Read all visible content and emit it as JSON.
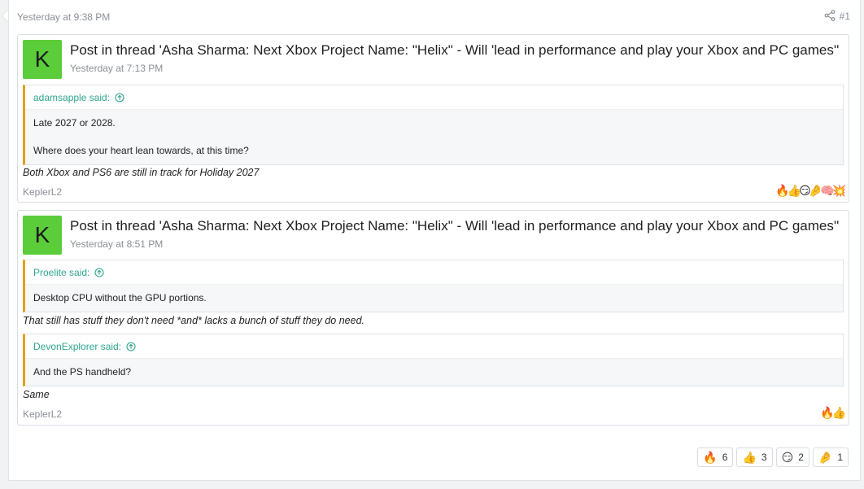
{
  "post": {
    "time": "Yesterday at 9:38 PM",
    "number": "#1"
  },
  "cards": [
    {
      "avatar_letter": "K",
      "title": "Post in thread 'Asha Sharma: Next Xbox Project Name: \"Helix\" - Will 'lead in performance and play your Xbox and PC games''",
      "time": "Yesterday at 7:13 PM",
      "quotes": [
        {
          "author": "adamsapple said:",
          "lines": [
            "Late 2027 or 2028.",
            "Where does your heart lean towards, at this time?"
          ]
        }
      ],
      "replies": [
        "Both Xbox and PS6 are still in track for Holiday 2027"
      ],
      "author": "KeplerL2",
      "mini_reactions": "🔥👍😏🤌🧠💥"
    },
    {
      "avatar_letter": "K",
      "title": "Post in thread 'Asha Sharma: Next Xbox Project Name: \"Helix\" - Will 'lead in performance and play your Xbox and PC games''",
      "time": "Yesterday at 8:51 PM",
      "quotes": [
        {
          "author": "Proelite said:",
          "lines": [
            "Desktop CPU without the GPU portions."
          ]
        },
        {
          "author": "DevonExplorer said:",
          "lines": [
            "And the PS handheld?"
          ]
        }
      ],
      "replies": [
        "That still has stuff they don't need *and* lacks a bunch of stuff they do need.",
        "Same"
      ],
      "author": "KeplerL2",
      "mini_reactions": "🔥👍"
    }
  ],
  "reactions": [
    {
      "emoji": "🔥",
      "count": "6"
    },
    {
      "emoji": "👍",
      "count": "3"
    },
    {
      "emoji": "😏",
      "count": "2"
    },
    {
      "emoji": "🤌",
      "count": "1"
    }
  ],
  "icons": {
    "share": "share-icon",
    "quote_up": "arrow-up-circle-icon"
  },
  "colors": {
    "accent": "#2fa68f",
    "quote_border": "#e2a01a",
    "avatar": "#5ccd3a"
  }
}
